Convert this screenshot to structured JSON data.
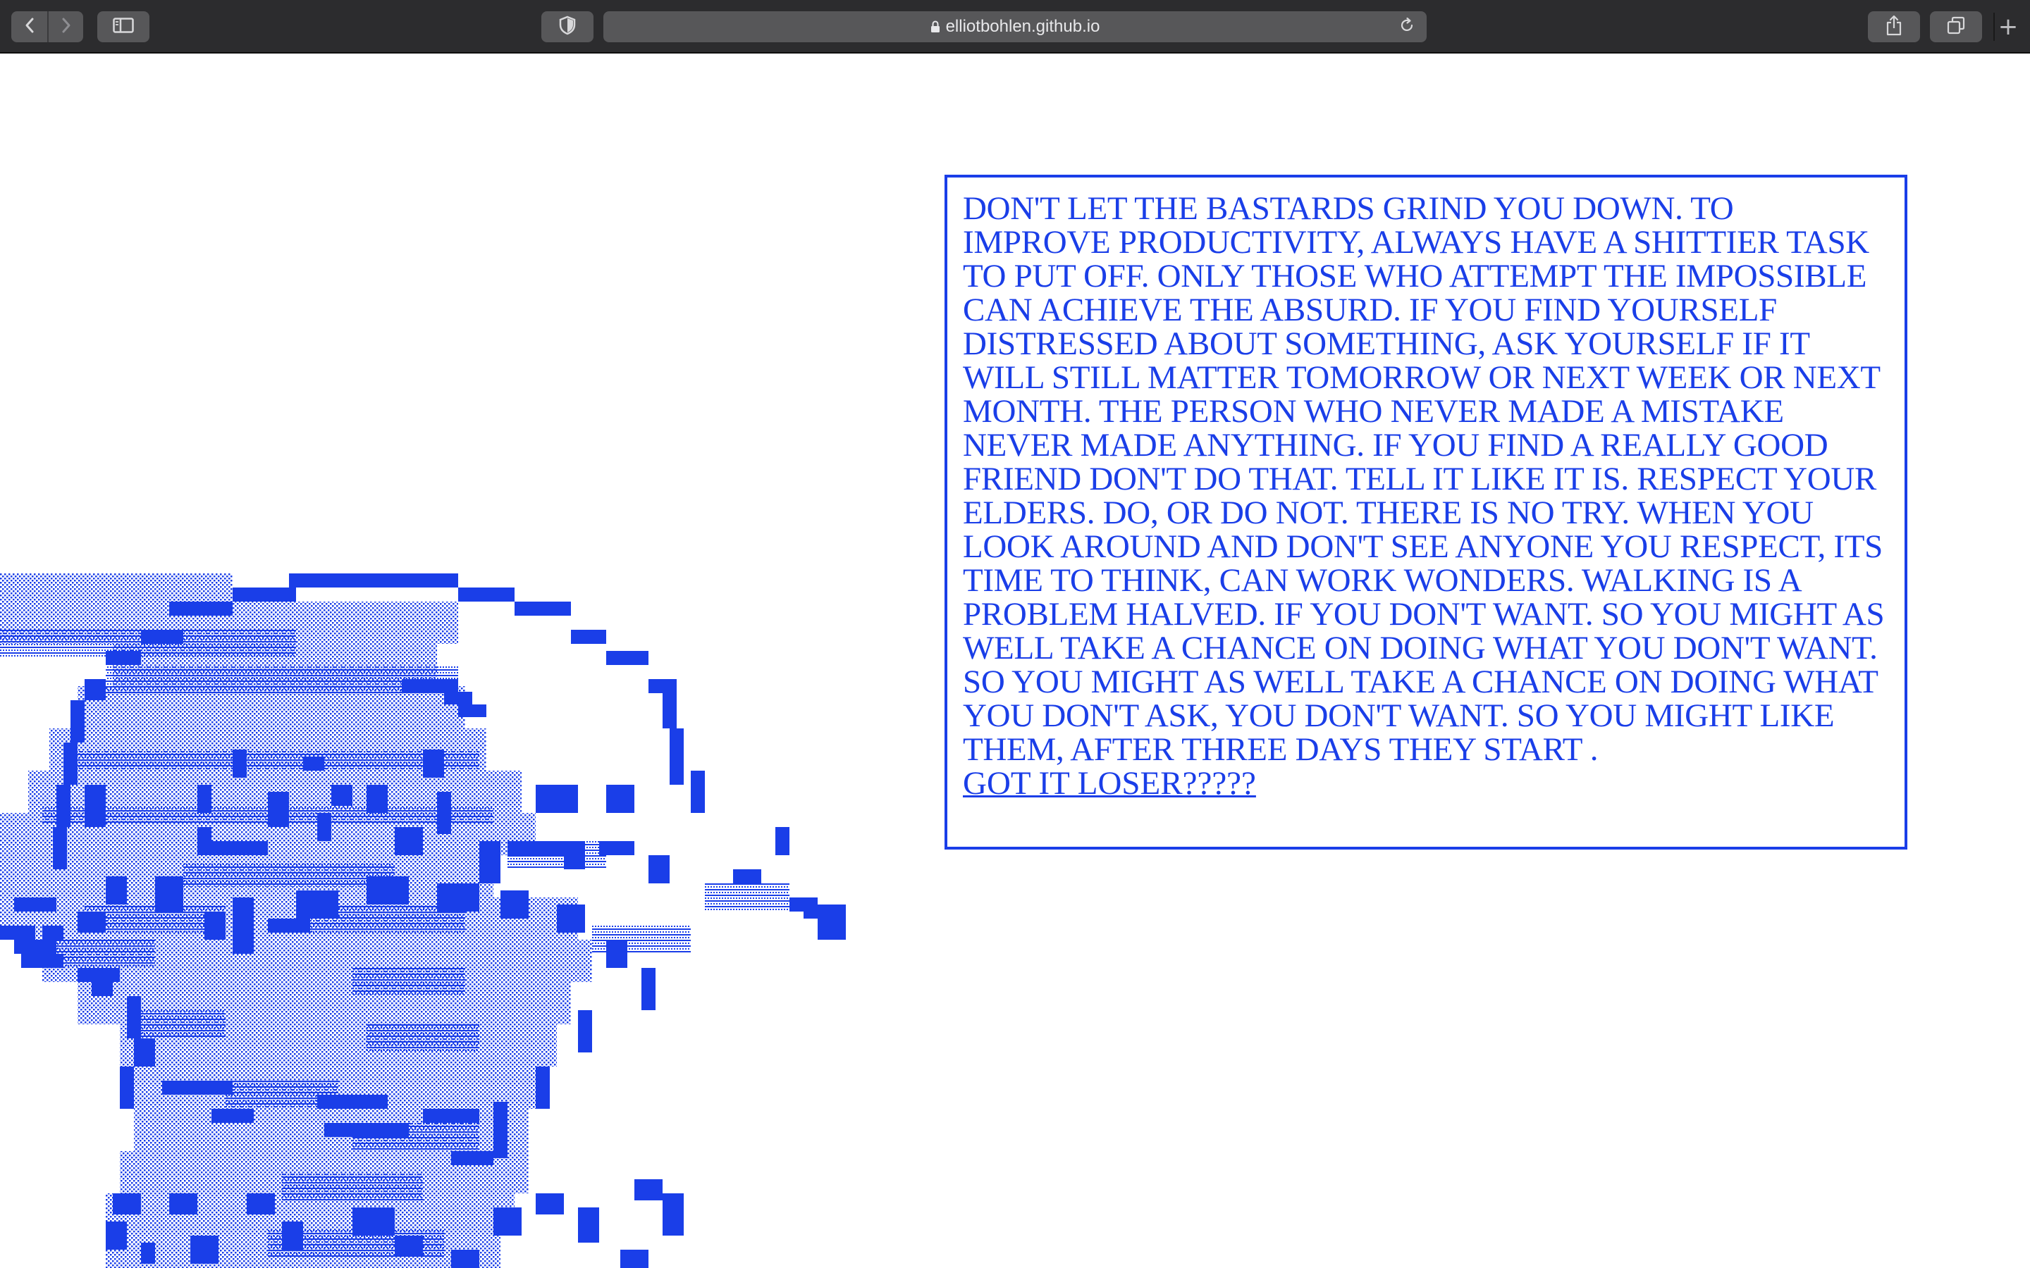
{
  "browser": {
    "url": "elliotbohlen.github.io",
    "new_tab_label": "+"
  },
  "colors": {
    "accent": "#1a3ee8",
    "chrome_bg": "#2c2c2e",
    "chrome_button": "#575759"
  },
  "icons": {
    "back": "chevron-left-icon",
    "forward": "chevron-right-icon",
    "sidebar": "sidebar-icon",
    "privacy": "shield-icon",
    "lock": "lock-icon",
    "reload": "reload-icon",
    "share": "share-icon",
    "tabs": "tabs-overview-icon"
  },
  "main": {
    "quote_text": "Don't let the bastards grind you down. To improve productivity, always have a shittier task to put off. Only those who attempt the impossible can achieve the absurd. If you find yourself distressed about something, ask yourself if it will still matter tomorrow or next week or next month. The person who never made a mistake never made anything. If you find a really good friend don't do that. Tell it like it is. Respect your elders. Do, or do not. There is no try. When you look around and don't see anyone you respect, its time to think, can work wonders. Walking is a problem halved. If you don't want. So you might as well take a chance on doing what you don't want. So you might as well take a chance on doing what you don't ask, you don't want. So you might like them, after three days they start .",
    "link_text": "GOT IT LOSER?????"
  }
}
